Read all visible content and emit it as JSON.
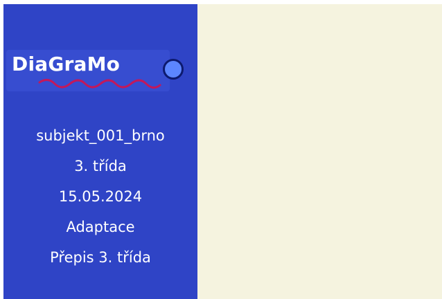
{
  "colors": {
    "sidebar_bg": "#2f44c6",
    "content_bg": "#f5f3df",
    "wave": "#c2185b",
    "dot": "#5c86ff"
  },
  "logo": {
    "text": "DiaGraMo",
    "icons": [
      "wave-underline",
      "blue-dot"
    ]
  },
  "session": {
    "subject": "subjekt_001_brno",
    "class": "3. třída",
    "date": "15.05.2024",
    "phase": "Adaptace",
    "transcript": "Přepis 3. třída"
  }
}
